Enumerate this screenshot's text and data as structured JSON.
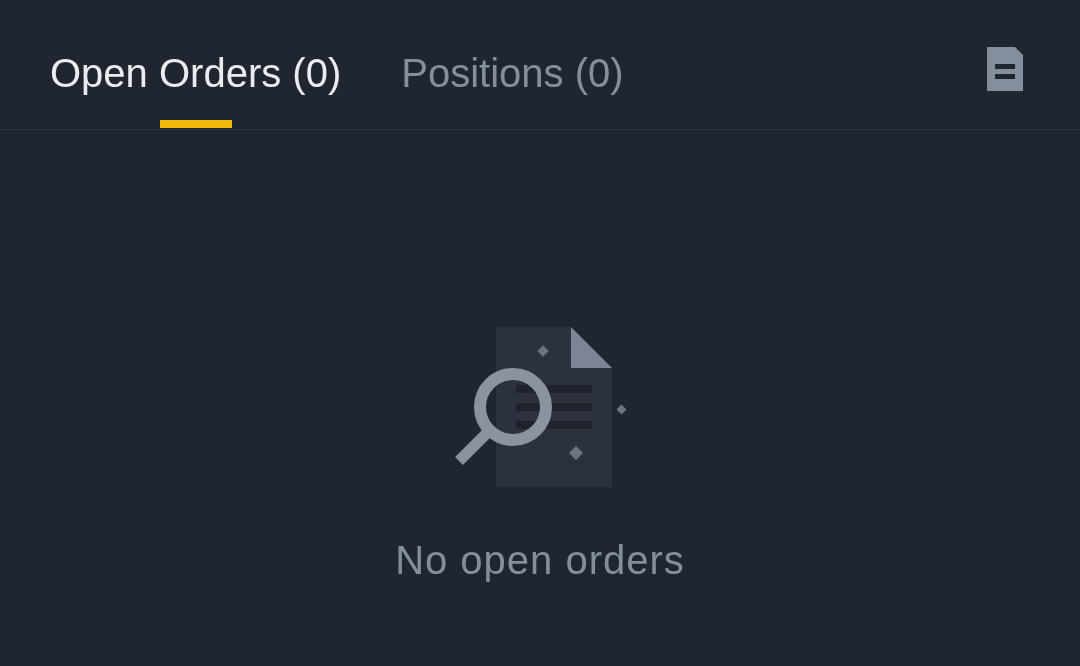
{
  "tabs": [
    {
      "label": "Open Orders (0)",
      "selected": true
    },
    {
      "label": "Positions (0)",
      "selected": false
    }
  ],
  "empty_state": {
    "message": "No open orders"
  }
}
